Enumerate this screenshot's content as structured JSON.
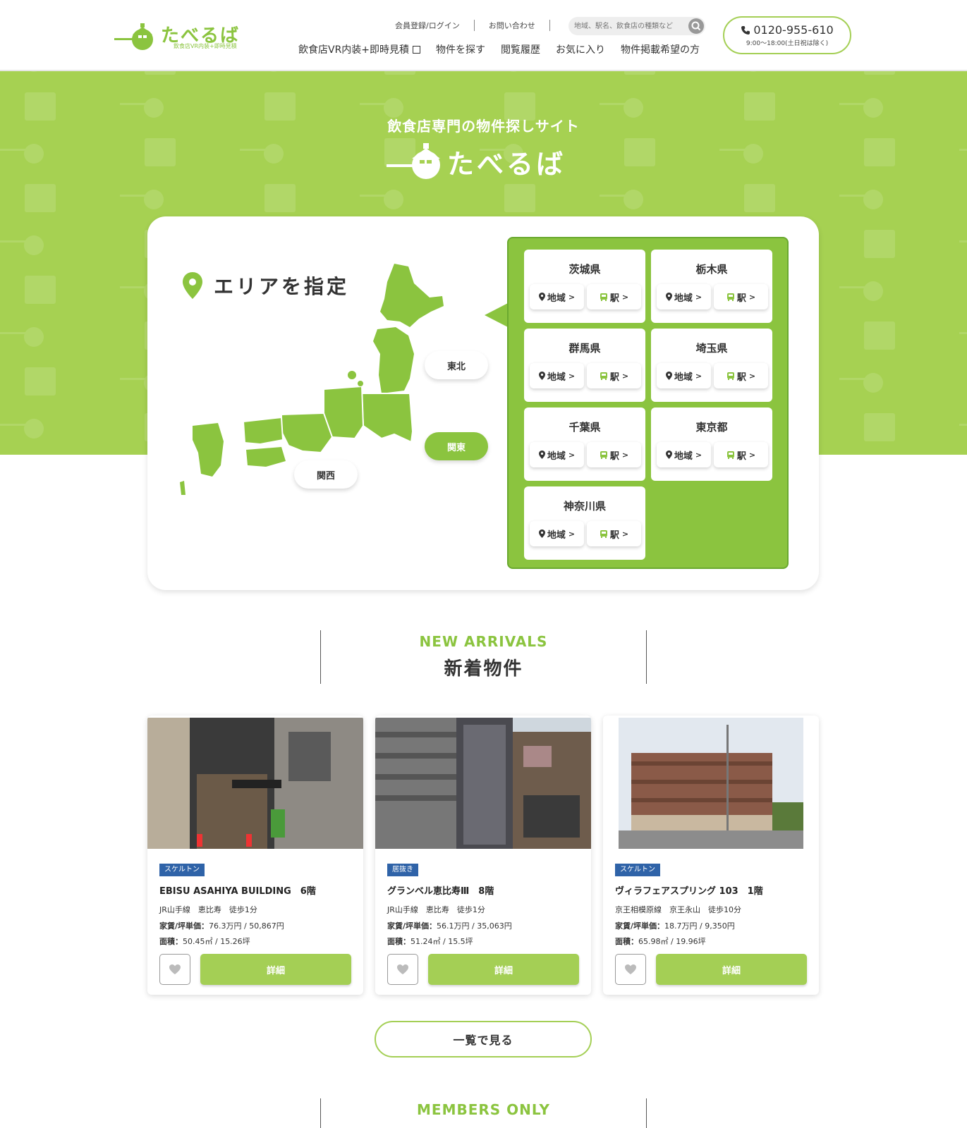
{
  "header": {
    "logo_text": "たべるば",
    "logo_sub": "飲食店VR内装+即時見積",
    "top_links": [
      "会員登録/ログイン",
      "お問い合わせ"
    ],
    "search_placeholder": "地域、駅名、飲食店の種類など",
    "nav": [
      "飲食店VR内装+即時見積",
      "物件を探す",
      "閲覧履歴",
      "お気に入り",
      "物件掲載希望の方"
    ],
    "phone": "0120-955-610",
    "phone_hours": "9:00〜18:00(土日祝は除く)"
  },
  "hero": {
    "tagline": "飲食店専門の物件探しサイト",
    "logo_text": "たべるば"
  },
  "area": {
    "title": "エリアを指定",
    "regions": [
      {
        "label": "東北",
        "active": false
      },
      {
        "label": "関東",
        "active": true
      },
      {
        "label": "関西",
        "active": false
      }
    ],
    "area_label": "地域",
    "station_label": "駅",
    "prefectures": [
      "茨城県",
      "栃木県",
      "群馬県",
      "埼玉県",
      "千葉県",
      "東京都",
      "神奈川県"
    ]
  },
  "new_arrivals": {
    "en": "NEW ARRIVALS",
    "ja": "新着物件",
    "rent_label": "家賃/坪単価：",
    "size_label": "面積：",
    "detail_label": "詳細",
    "properties": [
      {
        "tag": "スケルトン",
        "title": "EBISU ASAHIYA BUILDING　6階",
        "station": "JR山手線　恵比寿　徒歩1分",
        "rent": "76.3万円 / 50,867円",
        "size": "50.45㎡ / 15.26坪"
      },
      {
        "tag": "居抜き",
        "title": "グランベル恵比寿Ⅲ　8階",
        "station": "JR山手線　恵比寿　徒歩1分",
        "rent": "56.1万円 / 35,063円",
        "size": "51.24㎡ / 15.5坪"
      },
      {
        "tag": "スケルトン",
        "title": "ヴィラフェアスプリング 103　1階",
        "station": "京王相模原線　京王永山　徒歩10分",
        "rent": "18.7万円 / 9,350円",
        "size": "65.98㎡ / 19.96坪"
      }
    ],
    "list_button": "一覧で見る"
  },
  "members": {
    "en": "MEMBERS ONLY"
  },
  "colors": {
    "brand_green": "#8bc43f",
    "hero_green": "#a6d152",
    "tag_blue": "#2f63a8"
  }
}
